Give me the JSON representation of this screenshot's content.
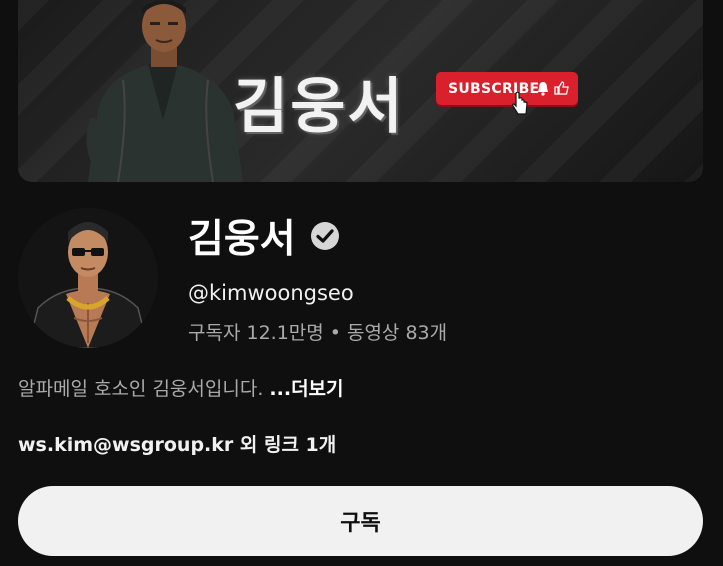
{
  "banner": {
    "title": "김웅서",
    "subscribe_label": "SUBSCRIBE"
  },
  "channel": {
    "name": "김웅서",
    "handle": "@kimwoongseo",
    "subscribers": "구독자 12.1만명",
    "separator": "•",
    "videos": "동영상 83개",
    "description": "알파메일 호소인 김웅서입니다.",
    "more_label": "...더보기",
    "link_text": "ws.kim@wsgroup.kr",
    "link_suffix": "외 링크 1개",
    "subscribe_button": "구독"
  },
  "colors": {
    "background": "#0f0f0f",
    "subscribe_red": "#d9202c",
    "button_bg": "#f1f1f1",
    "secondary_text": "#aaaaaa"
  }
}
